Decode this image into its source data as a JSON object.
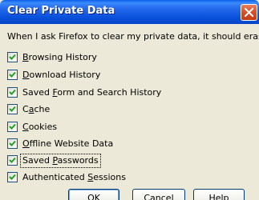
{
  "window": {
    "title": "Clear Private Data",
    "close_icon": "close-icon"
  },
  "prompt": "When I ask Firefox to clear my private data, it should erase:",
  "options": [
    {
      "pre": "",
      "key": "B",
      "post": "rowsing History",
      "checked": true
    },
    {
      "pre": "",
      "key": "D",
      "post": "ownload History",
      "checked": true
    },
    {
      "pre": "Saved ",
      "key": "F",
      "post": "orm and Search History",
      "checked": true
    },
    {
      "pre": "C",
      "key": "a",
      "post": "che",
      "checked": true
    },
    {
      "pre": "",
      "key": "C",
      "post": "ookies",
      "checked": true
    },
    {
      "pre": "",
      "key": "O",
      "post": "ffline Website Data",
      "checked": true
    },
    {
      "pre": "Saved ",
      "key": "P",
      "post": "asswords",
      "checked": true
    },
    {
      "pre": "Authenticated ",
      "key": "S",
      "post": "essions",
      "checked": true
    }
  ],
  "buttons": {
    "ok": "OK",
    "cancel": "Cancel",
    "help": "Help"
  },
  "colors": {
    "titlebar": "#0a52dc",
    "dialog_bg": "#ece9d8",
    "checkmark": "#21a121",
    "close_button": "#d9512a"
  }
}
